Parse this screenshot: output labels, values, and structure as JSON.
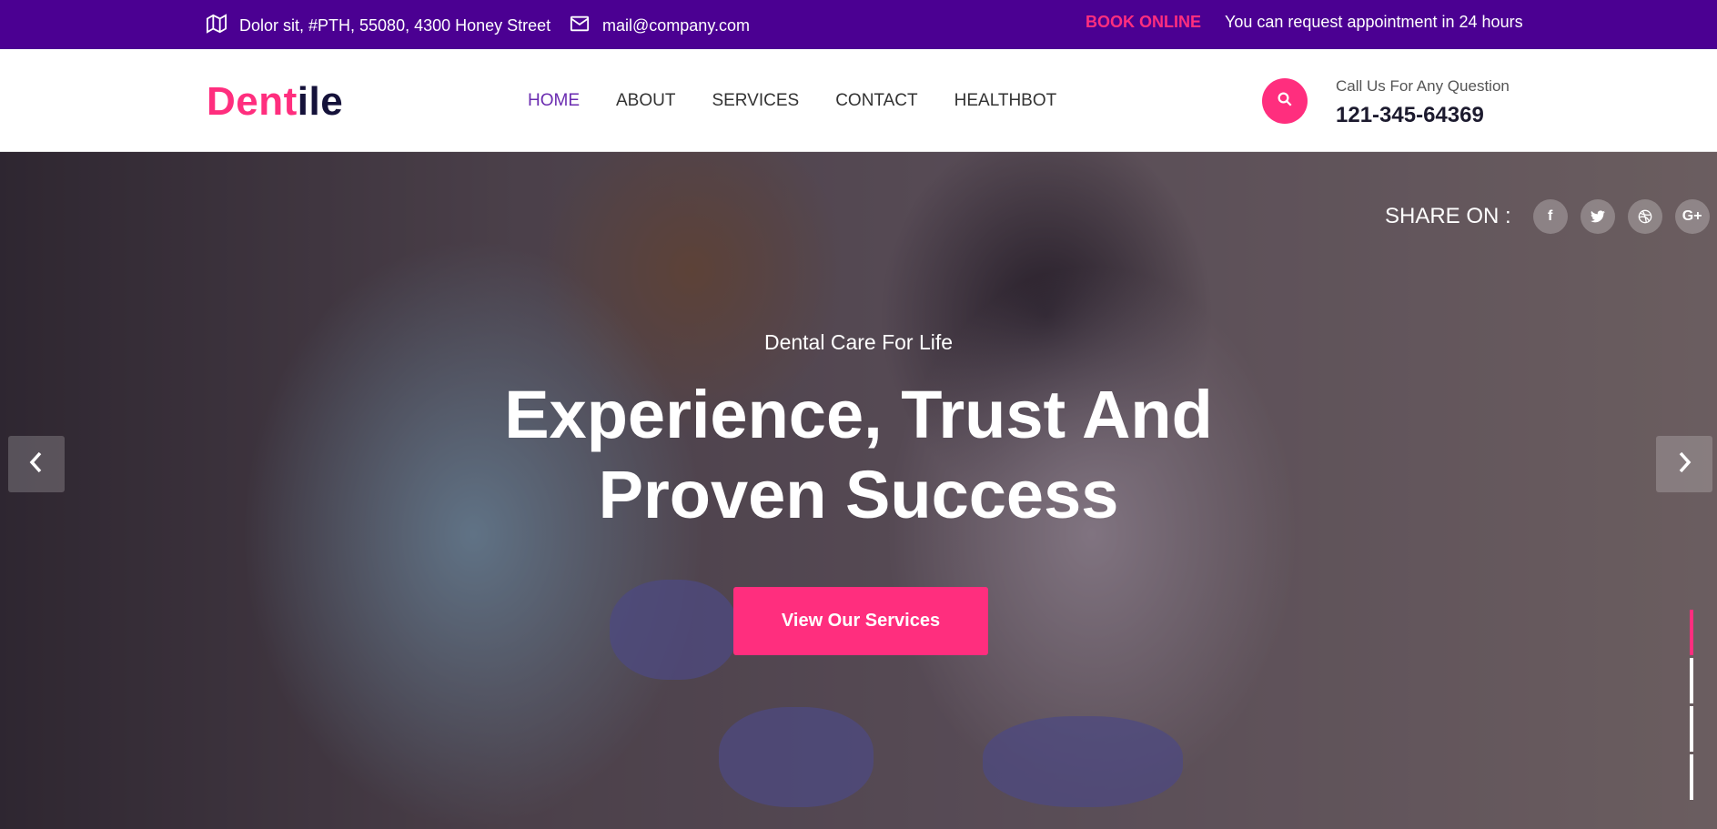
{
  "topbar": {
    "address": "Dolor sit, #PTH, 55080, 4300 Honey Street",
    "email": "mail@company.com",
    "book_label": "BOOK ONLINE",
    "request_text": "You can request appointment in 24 hours"
  },
  "header": {
    "logo_part1": "Dent",
    "logo_part2": "ile",
    "nav": [
      "HOME",
      "ABOUT",
      "SERVICES",
      "CONTACT",
      "HEALTHBOT"
    ],
    "active_nav": "HOME",
    "call_question": "Call Us For Any Question",
    "call_number": "121-345-64369"
  },
  "hero": {
    "share_label": "SHARE ON :",
    "social": [
      "facebook-icon",
      "twitter-icon",
      "dribbble-icon",
      "google-plus-icon"
    ],
    "subtitle": "Dental Care For Life",
    "headline_line1": "Experience, Trust And",
    "headline_line2": "Proven Success",
    "cta_label": "View Our Services",
    "slides_count": 4,
    "active_slide": 1
  },
  "colors": {
    "topbar_bg": "#4b0092",
    "accent": "#ff2e7e",
    "nav_active": "#6a2bb0"
  }
}
